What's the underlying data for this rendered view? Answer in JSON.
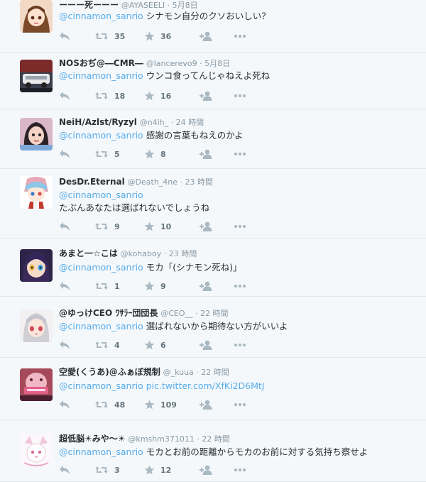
{
  "tweets": [
    {
      "name": "ーーー死ーーー",
      "handle": "@AYASEELI",
      "time": "5月8日",
      "mention": "@cinnamon_sanrio",
      "text": "シナモン自分のクソおいしい？",
      "text2": "",
      "link": "",
      "retweets": "35",
      "favorites": "36"
    },
    {
      "name": "NOSおぢ@―CMR―",
      "handle": "@lancerevo9",
      "time": "5月8日",
      "mention": "@cinnamon_sanrio",
      "text": "ウンコ食ってんじゃねえよ死ね",
      "text2": "",
      "link": "",
      "retweets": "18",
      "favorites": "16"
    },
    {
      "name": "NeiH/Azlst/Ryzyl",
      "handle": "@n4ih_",
      "time": "24 時間",
      "mention": "@cinnamon_sanrio",
      "text": "感謝の言葉もねえのかよ",
      "text2": "",
      "link": "",
      "retweets": "5",
      "favorites": "8"
    },
    {
      "name": "DesDr.Eternal",
      "handle": "@Death_4ne",
      "time": "23 時間",
      "mention": "@cinnamon_sanrio",
      "text": "",
      "text2": "たぶんあなたは選ばれないでしょうね",
      "link": "",
      "retweets": "9",
      "favorites": "10"
    },
    {
      "name": "あまと一☆こは",
      "handle": "@kohaboy",
      "time": "23 時間",
      "mention": "@cinnamon_sanrio",
      "text": "モカ「(シナモン死ね)」",
      "text2": "",
      "link": "",
      "retweets": "1",
      "favorites": "9"
    },
    {
      "name": "@ゆっけCEO ﾜｻﾗｰ団団長",
      "handle": "@CEO__",
      "time": "22 時間",
      "mention": "@cinnamon_sanrio",
      "text": "選ばれないから期待ない方がいいよ",
      "text2": "",
      "link": "",
      "retweets": "4",
      "favorites": "6"
    },
    {
      "name": "空愛(くうあ)@ふぁぼ規制",
      "handle": "@_kuua",
      "time": "22 時間",
      "mention": "@cinnamon_sanrio",
      "text": "",
      "text2": "",
      "link": "pic.twitter.com/XfKi2D6MtJ",
      "retweets": "48",
      "favorites": "109"
    },
    {
      "name": "超低脳☀みや～☀",
      "handle": "@kmshm371011",
      "time": "22 時間",
      "mention": "@cinnamon_sanrio",
      "text": "モカとお前の距離からモカのお前に対する気持ち察せよ",
      "text2": "",
      "link": "",
      "retweets": "3",
      "favorites": "12"
    }
  ],
  "icons": {
    "reply": "reply-icon",
    "retweet": "retweet-icon",
    "favorite": "star-icon",
    "follow": "follow-icon",
    "more": "more-icon"
  },
  "colors": {
    "link": "#55acee",
    "muted": "#8899a6",
    "icon": "#aab8c2",
    "background": "#f5f8fa",
    "divider": "#e1e8ed"
  }
}
